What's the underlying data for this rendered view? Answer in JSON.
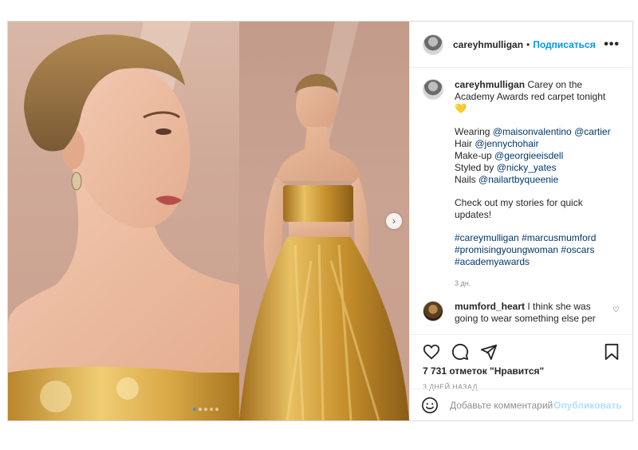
{
  "post": {
    "username": "careyhmulligan",
    "follow_label": "Подписаться",
    "separator": "•",
    "more_icon": "more-options-icon",
    "caption": {
      "line1_text": "Carey on the Academy Awards red carpet tonight",
      "heart_emoji": "💛",
      "wearing_label": "Wearing",
      "wearing_mention_1": "@maisonvalentino",
      "wearing_mention_2": "@cartier",
      "hair_label": "Hair",
      "hair_mention": "@jennychohair",
      "makeup_label": "Make-up",
      "makeup_mention": "@georgieeisdell",
      "styled_label": "Styled by",
      "styled_mention": "@nicky_yates",
      "nails_label": "Nails",
      "nails_mention": "@nailartbyqueenie",
      "stories_text": "Check out my stories for quick updates!",
      "tags": [
        "#careymulligan",
        "#marcusmumford",
        "#promisingyoungwoman",
        "#oscars",
        "#academyawards"
      ],
      "time": "3 дн."
    },
    "comment": {
      "username": "mumford_heart",
      "text": "I think she was going to wear something else per"
    },
    "likes_text": "7 731 отметок \"Нравится\"",
    "date_text": "3 ДНЕЙ НАЗАД",
    "add_comment": {
      "placeholder": "Добавьте комментарий...",
      "publish_label": "Опубликовать"
    },
    "carousel": {
      "slide_count": 5,
      "active_index": 0
    },
    "colors": {
      "accent": "#0095f6",
      "mention": "#00376b",
      "muted": "#8e8e8e",
      "gold": "#d4a83a",
      "heart": "#f2c400"
    }
  }
}
